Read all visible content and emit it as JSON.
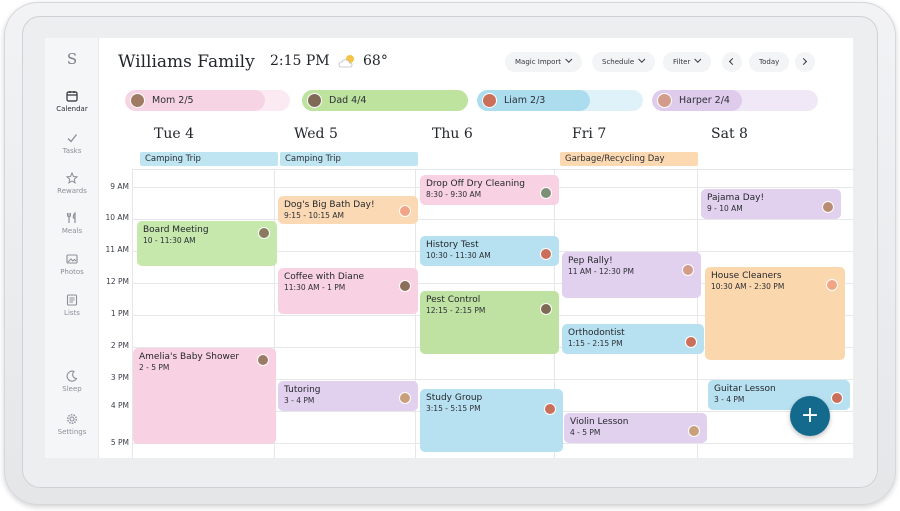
{
  "app": {
    "logo": "S",
    "family_title": "Williams Family",
    "time": "2:15 PM",
    "temperature": "68°",
    "weather_icon": "partly-cloudy-icon"
  },
  "sidebar": {
    "items": [
      {
        "label": "Calendar",
        "icon": "calendar-icon",
        "active": true
      },
      {
        "label": "Tasks",
        "icon": "check-icon",
        "active": false
      },
      {
        "label": "Rewards",
        "icon": "star-icon",
        "active": false
      },
      {
        "label": "Meals",
        "icon": "utensils-icon",
        "active": false
      },
      {
        "label": "Photos",
        "icon": "photo-icon",
        "active": false
      },
      {
        "label": "Lists",
        "icon": "list-icon",
        "active": false
      },
      {
        "label": "Sleep",
        "icon": "moon-icon",
        "active": false
      },
      {
        "label": "Settings",
        "icon": "gear-icon",
        "active": false
      }
    ]
  },
  "toolbar": {
    "magic_import": "Magic Import",
    "schedule": "Schedule",
    "filter": "Filter",
    "today": "Today"
  },
  "people": [
    {
      "label": "Mom 2/5",
      "color": "#f7cfe0",
      "progress": 0.4
    },
    {
      "label": "Dad 4/4",
      "color": "#bde39e",
      "progress": 1.0
    },
    {
      "label": "Liam 2/3",
      "color": "#a9dcef",
      "progress": 0.67
    },
    {
      "label": "Harper 2/4",
      "color": "#dcc6ea",
      "progress": 0.5
    }
  ],
  "days": [
    {
      "label": "Tue 4",
      "all_day": "Camping Trip"
    },
    {
      "label": "Wed 5",
      "all_day": "Camping Trip"
    },
    {
      "label": "Thu 6",
      "all_day": ""
    },
    {
      "label": "Fri 7",
      "all_day": "Garbage/Recycling Day"
    },
    {
      "label": "Sat 8",
      "all_day": ""
    }
  ],
  "hours": [
    "9 AM",
    "10 AM",
    "11 AM",
    "12 PM",
    "1 PM",
    "2 PM",
    "3 PM",
    "4 PM",
    "5 PM"
  ],
  "events": [
    {
      "title": "Board Meeting",
      "time": "10 - 11:30 AM",
      "color": "#c6e8ad"
    },
    {
      "title": "Amelia's Baby Shower",
      "time": "2 - 5 PM",
      "color": "#f8d2e3"
    },
    {
      "title": "Dog's Big Bath Day!",
      "time": "9:15 - 10:15 AM",
      "color": "#fbd9b4"
    },
    {
      "title": "Coffee with Diane",
      "time": "11:30 AM - 1 PM",
      "color": "#f8d2e3"
    },
    {
      "title": "Tutoring",
      "time": "3 - 4 PM",
      "color": "#e2d0ef"
    },
    {
      "title": "Drop Off Dry Cleaning",
      "time": "8:30 - 9:30 AM",
      "color": "#f8d2e3"
    },
    {
      "title": "History Test",
      "time": "10:30 - 11:30 AM",
      "color": "#b7e1f1"
    },
    {
      "title": "Pest Control",
      "time": "12:15 - 2:15 PM",
      "color": "#bfe2a3"
    },
    {
      "title": "Study Group",
      "time": "3:15 - 5:15 PM",
      "color": "#b7e1f1"
    },
    {
      "title": "Pep Rally!",
      "time": "11 AM - 12:30 PM",
      "color": "#e2d0ef"
    },
    {
      "title": "Orthodontist",
      "time": "1:15 - 2:15 PM",
      "color": "#b7e1f1"
    },
    {
      "title": "Violin Lesson",
      "time": "4 - 5 PM",
      "color": "#e2d0ef"
    },
    {
      "title": "Pajama Day!",
      "time": "9 - 10 AM",
      "color": "#e2d0ef"
    },
    {
      "title": "House Cleaners",
      "time": "10:30 AM - 2:30 PM",
      "color": "#fbd7ae"
    },
    {
      "title": "Guitar Lesson",
      "time": "3 - 4 PM",
      "color": "#b7e1f1"
    }
  ],
  "fab": {
    "label": "+"
  }
}
